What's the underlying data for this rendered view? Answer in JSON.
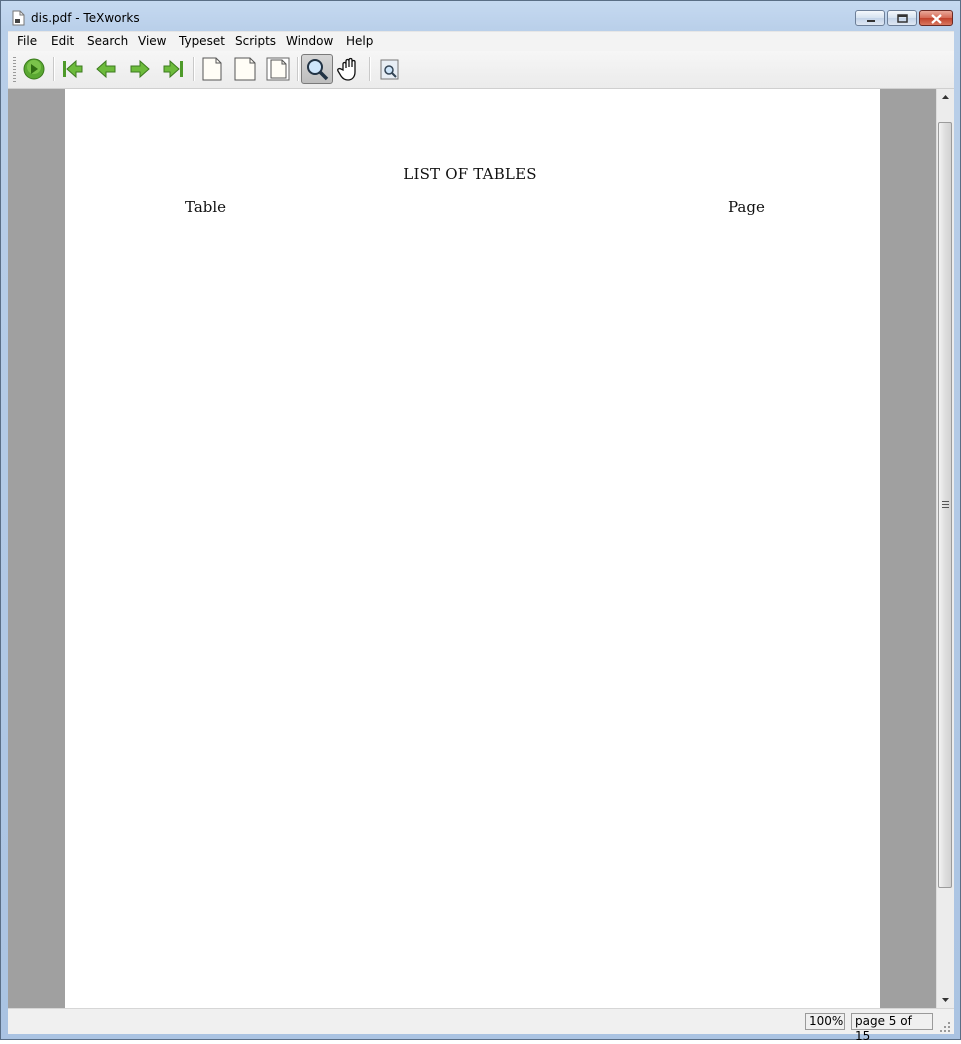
{
  "window": {
    "title": "dis.pdf - TeXworks"
  },
  "menubar": {
    "items": [
      "File",
      "Edit",
      "Search",
      "View",
      "Typeset",
      "Scripts",
      "Window",
      "Help"
    ]
  },
  "toolbar": {
    "buttons": [
      {
        "name": "typeset-button",
        "icon": "play-icon"
      },
      {
        "name": "first-page-button",
        "icon": "first-page-icon"
      },
      {
        "name": "previous-page-button",
        "icon": "arrow-left-icon"
      },
      {
        "name": "next-page-button",
        "icon": "arrow-right-icon"
      },
      {
        "name": "last-page-button",
        "icon": "last-page-icon"
      },
      {
        "name": "actual-size-button",
        "icon": "page-icon"
      },
      {
        "name": "fit-width-button",
        "icon": "page-icon"
      },
      {
        "name": "fit-window-button",
        "icon": "page-icon"
      },
      {
        "name": "magnify-tool-button",
        "icon": "magnifier-icon",
        "active": true
      },
      {
        "name": "scroll-tool-button",
        "icon": "hand-icon"
      },
      {
        "name": "find-source-button",
        "icon": "search-page-icon"
      }
    ]
  },
  "document": {
    "title": "LIST OF TABLES",
    "column_left": "Table",
    "column_right": "Page"
  },
  "statusbar": {
    "zoom": "100%",
    "page": "page 5 of 15"
  },
  "colors": {
    "viewer_background": "#a0a0a0",
    "page": "#ffffff",
    "toolbar_icon_green": "#5aa832"
  }
}
